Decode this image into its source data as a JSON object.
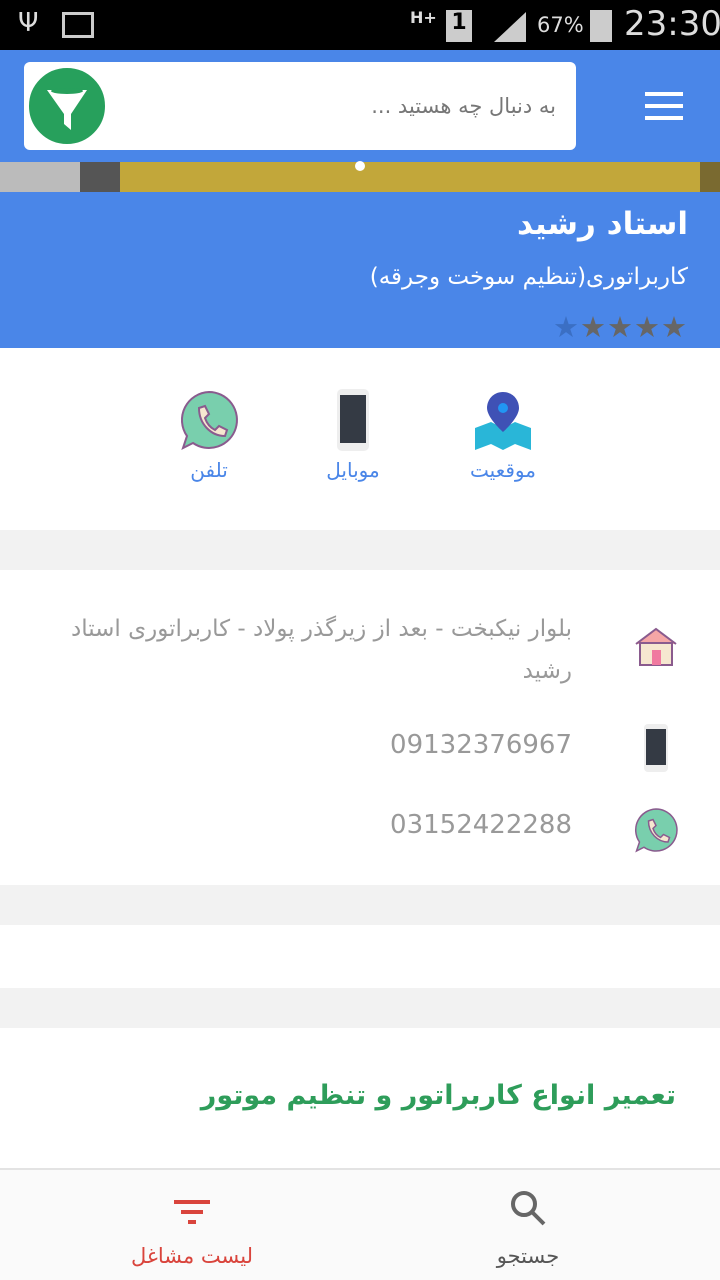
{
  "status_bar": {
    "network": "H+",
    "sim": "1",
    "battery": "67%",
    "time": "23:30"
  },
  "header": {
    "search_placeholder": "به دنبال چه هستید ...",
    "filter_icon": "funnel-icon",
    "menu_icon": "hamburger-icon"
  },
  "business": {
    "name": "استاد رشید",
    "category": "کاربراتوری(تنظیم سوخت وجرقه)",
    "rating": 4,
    "rating_max": 5
  },
  "actions": [
    {
      "label": "موقعیت",
      "icon": "map-location-icon"
    },
    {
      "label": "موبایل",
      "icon": "mobile-icon"
    },
    {
      "label": "تلفن",
      "icon": "phone-chat-icon"
    }
  ],
  "details": {
    "address": "بلوار نیکبخت - بعد از زیرگذر پولاد - کاربراتوری استاد رشید",
    "mobile": "09132376967",
    "phone": "03152422288"
  },
  "description": "تعمیر انواع کاربراتور و تنظیم موتور",
  "bottom_nav": {
    "search_label": "جستجو",
    "list_label": "لیست مشاغل",
    "active_color": "#d9443c"
  }
}
